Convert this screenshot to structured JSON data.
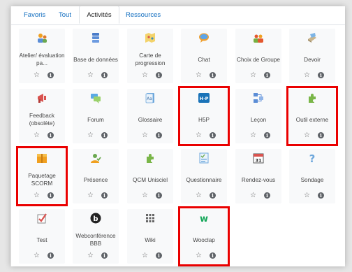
{
  "tabs": [
    {
      "label": "Favoris"
    },
    {
      "label": "Tout"
    },
    {
      "label": "Activités"
    },
    {
      "label": "Ressources"
    }
  ],
  "activities": [
    {
      "label": "Atelier/ évaluation pa...",
      "icon": "workshop-icon",
      "highlighted": false
    },
    {
      "label": "Base de données",
      "icon": "database-icon",
      "highlighted": false
    },
    {
      "label": "Carte de progression",
      "icon": "progress-map-icon",
      "highlighted": false
    },
    {
      "label": "Chat",
      "icon": "chat-icon",
      "highlighted": false
    },
    {
      "label": "Choix de Groupe",
      "icon": "group-choice-icon",
      "highlighted": false
    },
    {
      "label": "Devoir",
      "icon": "assignment-icon",
      "highlighted": false
    },
    {
      "label": "Feedback (obsolète)",
      "icon": "feedback-icon",
      "highlighted": false
    },
    {
      "label": "Forum",
      "icon": "forum-icon",
      "highlighted": false
    },
    {
      "label": "Glossaire",
      "icon": "glossary-icon",
      "highlighted": false
    },
    {
      "label": "H5P",
      "icon": "h5p-icon",
      "icon_text": "H·P",
      "highlighted": true
    },
    {
      "label": "Leçon",
      "icon": "lesson-icon",
      "highlighted": false
    },
    {
      "label": "Outil externe",
      "icon": "external-tool-icon",
      "highlighted": true
    },
    {
      "label": "Paquetage SCORM",
      "icon": "scorm-package-icon",
      "highlighted": true
    },
    {
      "label": "Présence",
      "icon": "attendance-icon",
      "highlighted": false
    },
    {
      "label": "QCM Unisciel",
      "icon": "qcm-icon",
      "highlighted": false
    },
    {
      "label": "Questionnaire",
      "icon": "questionnaire-icon",
      "highlighted": false
    },
    {
      "label": "Rendez-vous",
      "icon": "calendar-icon",
      "icon_text": "31",
      "highlighted": false
    },
    {
      "label": "Sondage",
      "icon": "survey-icon",
      "icon_text": "?",
      "highlighted": false
    },
    {
      "label": "Test",
      "icon": "quiz-icon",
      "highlighted": false
    },
    {
      "label": "Webconférence BBB",
      "icon": "bigbluebutton-icon",
      "icon_text": "b",
      "highlighted": false
    },
    {
      "label": "Wiki",
      "icon": "wiki-icon",
      "highlighted": false
    },
    {
      "label": "Wooclap",
      "icon": "wooclap-icon",
      "icon_text": "w",
      "highlighted": true
    }
  ],
  "controls": {
    "star": "☆",
    "info": "i"
  },
  "colors": {
    "tab_link": "#0f6cbf",
    "highlight": "#ea0000",
    "tile_bg": "#f8f9fa"
  }
}
